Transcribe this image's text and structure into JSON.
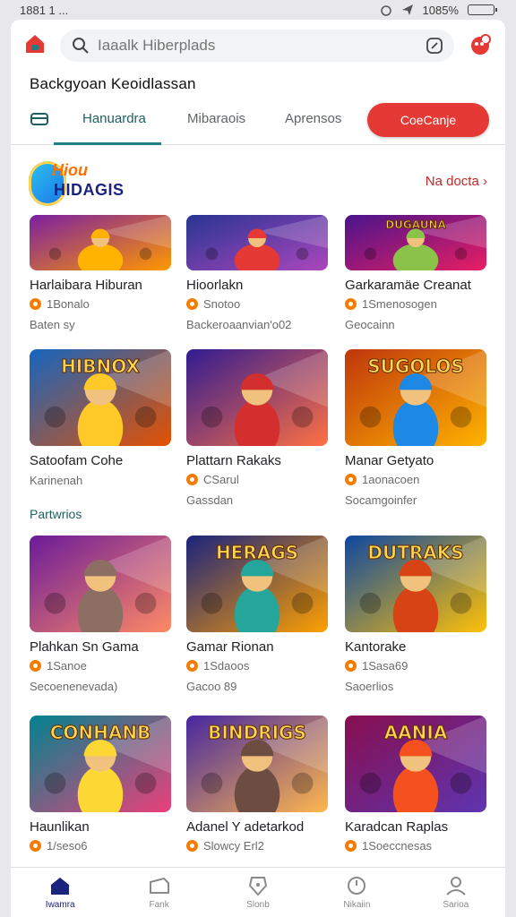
{
  "status_bar": {
    "time": "1881 1 ...",
    "battery": "1085%"
  },
  "search": {
    "placeholder": "Iaaalk Hiberplads"
  },
  "page_title": "Backgyoan Keoidlassan",
  "tabs": [
    {
      "label": "Hanuardra",
      "active": true
    },
    {
      "label": "Mibaraois",
      "active": false
    },
    {
      "label": "Aprensos",
      "active": false
    }
  ],
  "cta_button": "CoeCanje",
  "brand": {
    "top": "Hiou",
    "bottom": "HIDAGIS"
  },
  "see_more": "Na docta",
  "section_label": "Partwrios",
  "cards": [
    {
      "title": "Harlaibara Hiburan",
      "meta": "1Bonalo",
      "sub": "Baten sy"
    },
    {
      "title": "Hioorlakn",
      "meta": "Snotoo",
      "sub": "Backeroaanvian'o02"
    },
    {
      "title": "Garkaramäe Creanat",
      "meta": "1Smenosogen",
      "sub": "Geocainn"
    },
    {
      "title": "Satoofam Cohe",
      "meta": "",
      "sub": "Karinenah"
    },
    {
      "title": "Plattarn Rakaks",
      "meta": "CSarul",
      "sub": "Gassdan"
    },
    {
      "title": "Manar Getyato",
      "meta": "1aonacoen",
      "sub": "Socamgoinfer"
    },
    {
      "title": "Plahkan Sn Gama",
      "meta": "1Sanoe",
      "sub": "Secoenenevada)"
    },
    {
      "title": "Gamar Rionan",
      "meta": "1Sdaoos",
      "sub": "Gacoo 89"
    },
    {
      "title": "Kantorake",
      "meta": "1Sasa69",
      "sub": "Saoerlios"
    },
    {
      "title": "Haunlikan",
      "meta": "1/seso6",
      "sub": ""
    },
    {
      "title": "Adanel Y adetarkod",
      "meta": "Slowcy Erl2",
      "sub": ""
    },
    {
      "title": "Karadcan Raplas",
      "meta": "1Soeccnesas",
      "sub": ""
    }
  ],
  "thumbs": [
    {
      "bg1": "#7b1fa2",
      "bg2": "#ff9800",
      "figure": "#ffb300",
      "text": ""
    },
    {
      "bg1": "#283593",
      "bg2": "#ab47bc",
      "figure": "#e53935",
      "text": ""
    },
    {
      "bg1": "#4a148c",
      "bg2": "#e91e63",
      "figure": "#8bc34a",
      "text": "DUGAUNA"
    },
    {
      "bg1": "#1565c0",
      "bg2": "#e65100",
      "figure": "#ffca28",
      "text": "HIBNOX"
    },
    {
      "bg1": "#311b92",
      "bg2": "#ff7043",
      "figure": "#d32f2f",
      "text": ""
    },
    {
      "bg1": "#bf360c",
      "bg2": "#ffb300",
      "figure": "#1e88e5",
      "text": "SUGOLOS"
    },
    {
      "bg1": "#6a1b9a",
      "bg2": "#ff8a65",
      "figure": "#8d6e63",
      "text": ""
    },
    {
      "bg1": "#1a237e",
      "bg2": "#ffa000",
      "figure": "#26a69a",
      "text": "HERAGS"
    },
    {
      "bg1": "#0d47a1",
      "bg2": "#ffc107",
      "figure": "#d84315",
      "text": "DUTRAKS"
    },
    {
      "bg1": "#00838f",
      "bg2": "#ec407a",
      "figure": "#fdd835",
      "text": "CONHANB"
    },
    {
      "bg1": "#4527a0",
      "bg2": "#ffb74d",
      "figure": "#6d4c41",
      "text": "BINDRIGS"
    },
    {
      "bg1": "#880e4f",
      "bg2": "#5e35b1",
      "figure": "#f4511e",
      "text": "AANIA"
    }
  ],
  "nav": [
    {
      "label": "Iwamra",
      "icon": "home-icon",
      "active": true
    },
    {
      "label": "Fank",
      "icon": "games-icon",
      "active": false
    },
    {
      "label": "Slonb",
      "icon": "store-icon",
      "active": false
    },
    {
      "label": "Nikaiin",
      "icon": "clock-icon",
      "active": false
    },
    {
      "label": "Sarioa",
      "icon": "profile-icon",
      "active": false
    }
  ],
  "colors": {
    "accent": "#e53935",
    "tab_active": "#1f7f85",
    "nav_active": "#1a237e"
  }
}
